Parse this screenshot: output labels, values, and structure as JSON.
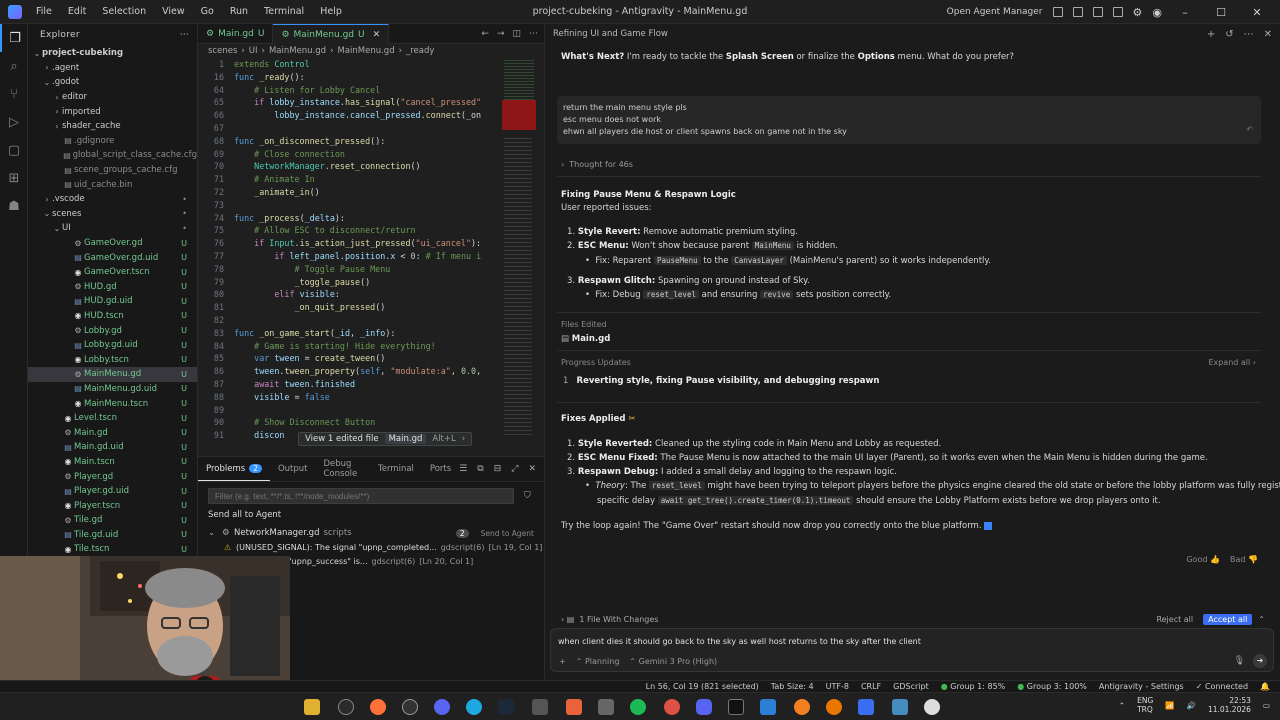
{
  "titlebar": {
    "menu": [
      "File",
      "Edit",
      "Selection",
      "View",
      "Go",
      "Run",
      "Terminal",
      "Help"
    ],
    "title": "project-cubeking - Antigravity - MainMenu.gd",
    "open_agent_manager": "Open Agent Manager"
  },
  "explorer": {
    "header": "Explorer",
    "root": "project-cubeking",
    "items": [
      {
        "label": ".agent",
        "depth": 1,
        "kind": "folder",
        "badge": ""
      },
      {
        "label": ".godot",
        "depth": 1,
        "kind": "folder",
        "badge": ""
      },
      {
        "label": "editor",
        "depth": 2,
        "kind": "folder",
        "badge": ""
      },
      {
        "label": "imported",
        "depth": 2,
        "kind": "folder",
        "badge": ""
      },
      {
        "label": "shader_cache",
        "depth": 2,
        "kind": "folder",
        "badge": ""
      },
      {
        "label": ".gdignore",
        "depth": 2,
        "kind": "file",
        "badge": ""
      },
      {
        "label": "global_script_class_cache.cfg",
        "depth": 2,
        "kind": "file",
        "badge": ""
      },
      {
        "label": "scene_groups_cache.cfg",
        "depth": 2,
        "kind": "file",
        "badge": ""
      },
      {
        "label": "uid_cache.bin",
        "depth": 2,
        "kind": "file",
        "badge": ""
      },
      {
        "label": ".vscode",
        "depth": 1,
        "kind": "folder",
        "badge": "•"
      },
      {
        "label": "scenes",
        "depth": 1,
        "kind": "folder",
        "badge": "•"
      },
      {
        "label": "UI",
        "depth": 2,
        "kind": "folder",
        "badge": "•"
      },
      {
        "label": "GameOver.gd",
        "depth": 3,
        "kind": "gd",
        "badge": "U"
      },
      {
        "label": "GameOver.gd.uid",
        "depth": 3,
        "kind": "uid",
        "badge": "U"
      },
      {
        "label": "GameOver.tscn",
        "depth": 3,
        "kind": "tscn",
        "badge": "U"
      },
      {
        "label": "HUD.gd",
        "depth": 3,
        "kind": "gd",
        "badge": "U"
      },
      {
        "label": "HUD.gd.uid",
        "depth": 3,
        "kind": "uid",
        "badge": "U"
      },
      {
        "label": "HUD.tscn",
        "depth": 3,
        "kind": "tscn",
        "badge": "U"
      },
      {
        "label": "Lobby.gd",
        "depth": 3,
        "kind": "gd",
        "badge": "U"
      },
      {
        "label": "Lobby.gd.uid",
        "depth": 3,
        "kind": "uid",
        "badge": "U"
      },
      {
        "label": "Lobby.tscn",
        "depth": 3,
        "kind": "tscn",
        "badge": "U"
      },
      {
        "label": "MainMenu.gd",
        "depth": 3,
        "kind": "gd",
        "badge": "U",
        "selected": true
      },
      {
        "label": "MainMenu.gd.uid",
        "depth": 3,
        "kind": "uid",
        "badge": "U"
      },
      {
        "label": "MainMenu.tscn",
        "depth": 3,
        "kind": "tscn",
        "badge": "U"
      },
      {
        "label": "Level.tscn",
        "depth": 2,
        "kind": "tscn",
        "badge": "U"
      },
      {
        "label": "Main.gd",
        "depth": 2,
        "kind": "gd",
        "badge": "U"
      },
      {
        "label": "Main.gd.uid",
        "depth": 2,
        "kind": "uid",
        "badge": "U"
      },
      {
        "label": "Main.tscn",
        "depth": 2,
        "kind": "tscn",
        "badge": "U"
      },
      {
        "label": "Player.gd",
        "depth": 2,
        "kind": "gd",
        "badge": "U"
      },
      {
        "label": "Player.gd.uid",
        "depth": 2,
        "kind": "uid",
        "badge": "U"
      },
      {
        "label": "Player.tscn",
        "depth": 2,
        "kind": "tscn",
        "badge": "U"
      },
      {
        "label": "Tile.gd",
        "depth": 2,
        "kind": "gd",
        "badge": "U"
      },
      {
        "label": "Tile.gd.uid",
        "depth": 2,
        "kind": "uid",
        "badge": "U"
      },
      {
        "label": "Tile.tscn",
        "depth": 2,
        "kind": "tscn",
        "badge": "U"
      }
    ]
  },
  "editor": {
    "tabs": [
      {
        "label": "Main.gd",
        "badge": "U"
      },
      {
        "label": "MainMenu.gd",
        "badge": "U"
      }
    ],
    "breadcrumbs": [
      "scenes",
      "UI",
      "MainMenu.gd",
      "MainMenu.gd",
      "_ready"
    ],
    "edited_tip": {
      "label": "View 1 edited file",
      "file": "Main.gd",
      "shortcut": "Alt+L"
    }
  },
  "panel": {
    "tabs": [
      {
        "label": "Problems",
        "count": "2"
      },
      {
        "label": "Output"
      },
      {
        "label": "Debug Console"
      },
      {
        "label": "Terminal"
      },
      {
        "label": "Ports"
      }
    ],
    "filter_placeholder": "Filter (e.g. text, **/*.ts, !**/node_modules/**)",
    "send_all": "Send all to Agent",
    "file_row": {
      "name": "NetworkManager.gd",
      "folder": "scripts",
      "count": "2",
      "action": "Send to Agent"
    },
    "problems": [
      {
        "text": "(UNUSED_SIGNAL): The signal \"upnp_completed...",
        "source": "gdscript(6)",
        "loc": "[Ln 19, Col 1]"
      },
      {
        "text": "): The signal \"upnp_success\" is...",
        "source": "gdscript(6)",
        "loc": "[Ln 20, Col 1]"
      }
    ]
  },
  "agent": {
    "header_title": "Refining UI and Game Flow",
    "whats_next": "What's Next?",
    "whats_next_text": " I'm ready to tackle the ",
    "splash": "Splash Screen",
    "or_finalize": " or finalize the ",
    "options": "Options",
    "menu_q": " menu. What do you prefer?",
    "user_msg": [
      "return the main menu style pls",
      "esc menu does not work",
      "ehwn all players die host or client spawns back on game not in the sky"
    ],
    "thought": "Thought for 46s",
    "fix_title": "Fixing Pause Menu & Respawn Logic",
    "user_reported": "User reported issues:",
    "issues": [
      {
        "n": "1.",
        "bold": "Style Revert:",
        "text": " Remove automatic premium styling."
      },
      {
        "n": "2.",
        "bold": "ESC Menu:",
        "text": " Won't show because parent ",
        "chip": "MainMenu",
        "tail": " is hidden."
      },
      {
        "n": "3.",
        "bold": "Respawn Glitch:",
        "text": " Spawning on ground instead of Sky."
      }
    ],
    "fix_esc": {
      "pre": "Fix: Reparent ",
      "chip1": "PauseMenu",
      "mid": " to the ",
      "chip2": "CanvasLayer",
      "tail": " (MainMenu's parent) so it works independently."
    },
    "fix_respawn": {
      "pre": "Fix: Debug ",
      "chip1": "reset_level",
      "mid": " and ensuring ",
      "chip2": "revive",
      "tail": " sets position correctly."
    },
    "files_edited": "Files Edited",
    "edited_file": "Main.gd",
    "progress_updates": "Progress Updates",
    "expand_all": "Expand all",
    "progress_item": {
      "n": "1",
      "text": "Reverting style, fixing Pause visibility, and debugging respawn"
    },
    "fixes_applied": "Fixes Applied",
    "applied": [
      {
        "n": "1.",
        "bold": "Style Reverted:",
        "text": " Cleaned up the styling code in Main Menu and Lobby as requested."
      },
      {
        "n": "2.",
        "bold": "ESC Menu Fixed:",
        "text": " The Pause Menu is now attached to the main UI layer (Parent), so it works even when the Main Menu is hidden during the game."
      },
      {
        "n": "3.",
        "bold": "Respawn Debug:",
        "text": " I added a small delay and logging to the respawn logic."
      }
    ],
    "theory_1": {
      "label": "Theory",
      "pre": ": The ",
      "chip": "reset_level",
      "text": " might have been trying to teleport players before the physics engine cleared the old state or before the lobby platform was fully registered. The"
    },
    "theory_2": {
      "pre": "specific delay ",
      "chip": "await get_tree().create_timer(0.1).timeout",
      "text": " should ensure the Lobby Platform exists before we drop players onto it."
    },
    "try_loop": "Try the loop again! The \"Game Over\" restart should now drop you correctly onto the blue platform.",
    "good": "Good",
    "bad": "Bad",
    "changes": "1 File With Changes",
    "reject_all": "Reject all",
    "accept_all": "Accept all",
    "input_value": "when client dies it should go back to the sky as well host returns to the sky after the client",
    "planning": "Planning",
    "model": "Gemini 3 Pro (High)"
  },
  "status": {
    "position": "Ln 56, Col 19 (821 selected)",
    "tab_size": "Tab Size: 4",
    "encoding": "UTF-8",
    "eol": "CRLF",
    "language": "GDScript",
    "group1": "Group 1: 85%",
    "group3": "Group 3: 100%",
    "settings": "Antigravity - Settings",
    "connected": "Connected"
  },
  "taskbar": {
    "lang": "ENG",
    "region": "TRQ",
    "time": "22:53",
    "date": "11.01.2026"
  },
  "colors": {
    "accent": "#3794ff",
    "git_untracked": "#73c991",
    "accept": "#3a6df0"
  }
}
